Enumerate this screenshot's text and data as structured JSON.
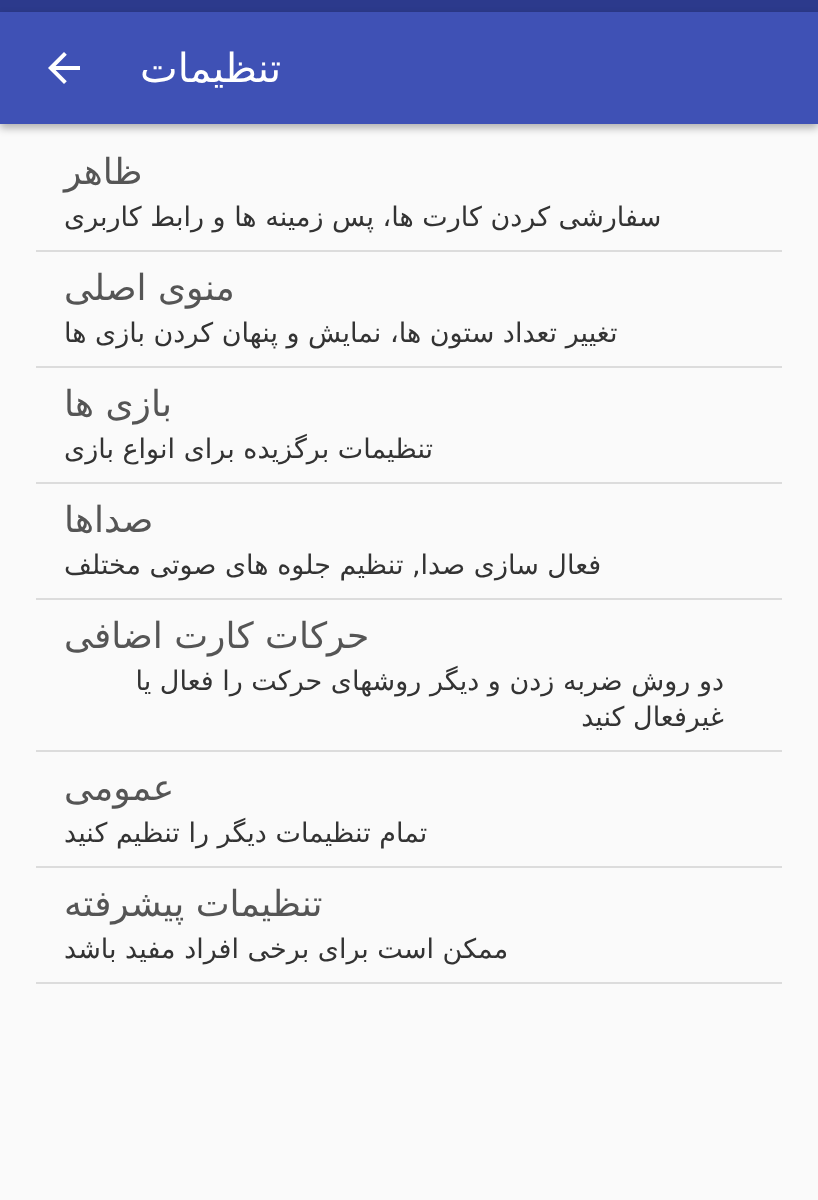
{
  "app_bar": {
    "title": "تنظیمات"
  },
  "settings": [
    {
      "title": "ظاهر",
      "summary": "سفارشی کردن کارت ها، پس زمینه ها و رابط کاربری"
    },
    {
      "title": "منوی اصلی",
      "summary": "تغییر تعداد ستون ها، نمایش و پنهان کردن بازی ها"
    },
    {
      "title": "بازی ها",
      "summary": "تنظیمات برگزیده برای انواع بازی"
    },
    {
      "title": "صداها",
      "summary": "فعال سازی صدا, تنظیم جلوه های صوتی مختلف"
    },
    {
      "title": "حرکات کارت اضافی",
      "summary": "دو روش ضربه زدن و دیگر روشهای حرکت را فعال یا غیرفعال کنید"
    },
    {
      "title": "عمومی",
      "summary": "تمام تنظیمات دیگر را تنظیم کنید"
    },
    {
      "title": "تنظیمات پیشرفته",
      "summary": "ممکن است برای برخی افراد مفید باشد"
    }
  ]
}
